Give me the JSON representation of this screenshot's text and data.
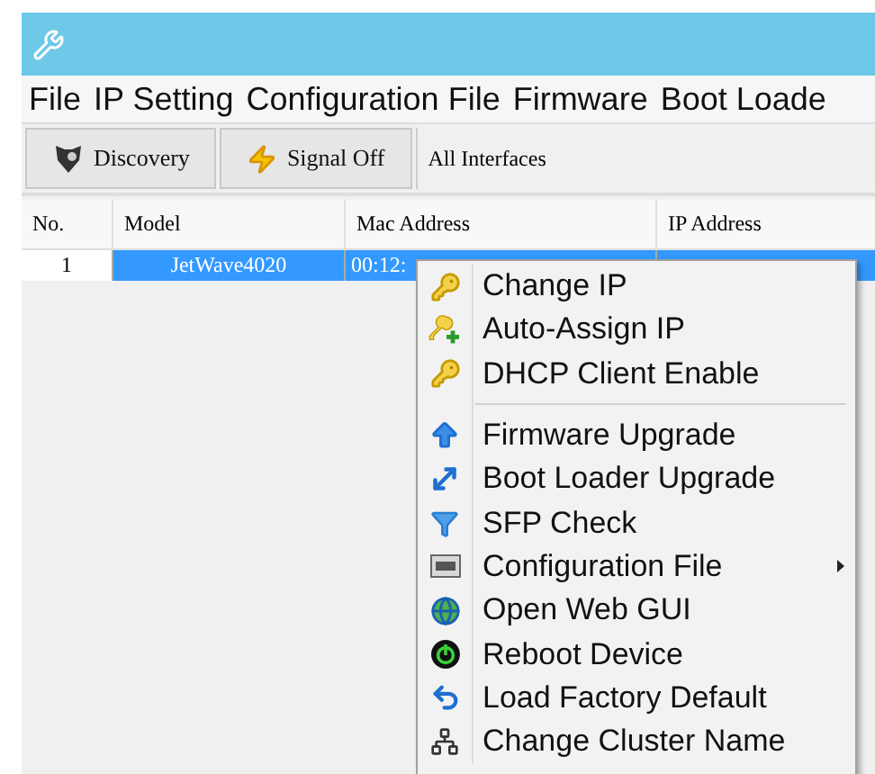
{
  "menu_bar": [
    "File",
    "IP Setting",
    "Configuration File",
    "Firmware",
    "Boot Loade"
  ],
  "toolbar": {
    "buttons": [
      "Discovery",
      "Signal Off"
    ],
    "interface": "All Interfaces"
  },
  "table": {
    "columns": [
      "No.",
      "Model",
      "Mac Address",
      "IP Address"
    ],
    "rows": [
      {
        "cells": [
          "1",
          "JetWave4020",
          "00:12:"
        ],
        "selected": true
      }
    ]
  },
  "context_menu": [
    {
      "kind": "item",
      "label": "Change IP"
    },
    {
      "kind": "item",
      "label": "Auto-Assign IP"
    },
    {
      "kind": "item",
      "label": "DHCP Client Enable"
    },
    {
      "kind": "separator"
    },
    {
      "kind": "item",
      "label": "Firmware Upgrade"
    },
    {
      "kind": "item",
      "label": "Boot Loader Upgrade"
    },
    {
      "kind": "item",
      "label": "SFP Check"
    },
    {
      "kind": "item",
      "label": "Configuration File",
      "submenu": true
    },
    {
      "kind": "item",
      "label": "Open Web GUI"
    },
    {
      "kind": "item",
      "label": "Reboot Device"
    },
    {
      "kind": "item",
      "label": "Load Factory Default"
    },
    {
      "kind": "item",
      "label": "Change Cluster Name"
    }
  ]
}
